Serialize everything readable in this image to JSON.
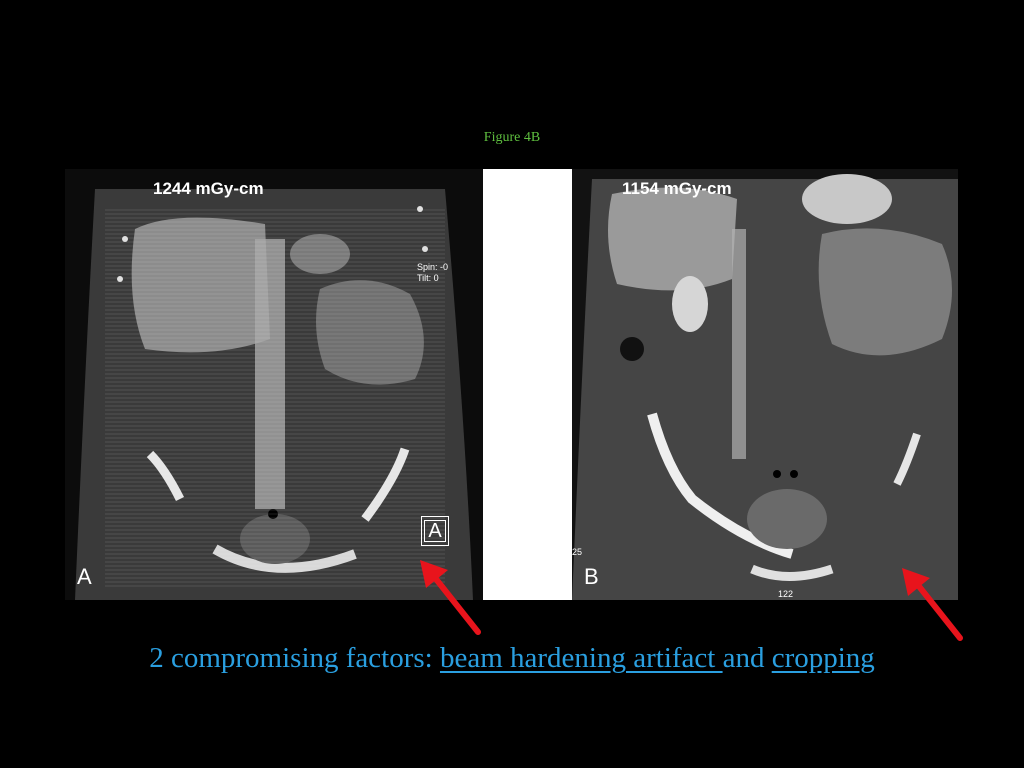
{
  "figure": {
    "title": "Figure 4B"
  },
  "panel_a": {
    "dose": "1244 mGy-cm",
    "letter": "A",
    "boxed_letter": "A",
    "small_text_1": "Spin: -0",
    "small_text_2": "Tilt: 0"
  },
  "panel_b": {
    "dose": "1154 mGy-cm",
    "letter": "B",
    "side_text": "25",
    "bottom_text": "122"
  },
  "caption": {
    "lead": "2 compromising factors: ",
    "factor_1": "beam hardening artifact ",
    "conjunction": "and ",
    "factor_2": "cropping"
  },
  "colors": {
    "background": "#000000",
    "title": "#5fbf3f",
    "caption": "#2a9fe0",
    "arrow": "#e8141c"
  },
  "icons": [
    "red-arrow-icon",
    "red-arrow-icon"
  ]
}
